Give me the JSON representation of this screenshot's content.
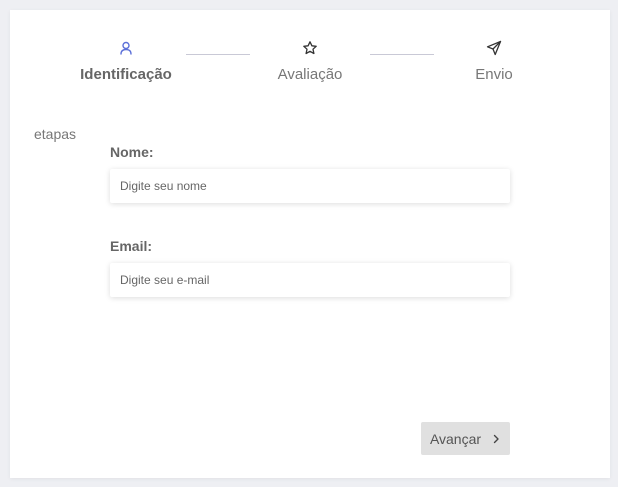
{
  "steps": [
    {
      "label": "Identificação",
      "icon": "user-icon",
      "active": true,
      "color": "#5b6fd8"
    },
    {
      "label": "Avaliação",
      "icon": "star-icon",
      "active": false
    },
    {
      "label": "Envio",
      "icon": "send-icon",
      "active": false
    }
  ],
  "side_label": "etapas",
  "form": {
    "name_label": "Nome:",
    "name_placeholder": "Digite seu nome",
    "name_value": "",
    "email_label": "Email:",
    "email_placeholder": "Digite seu e-mail",
    "email_value": ""
  },
  "next_button": {
    "label": "Avançar",
    "icon": "chevron-right-icon"
  }
}
